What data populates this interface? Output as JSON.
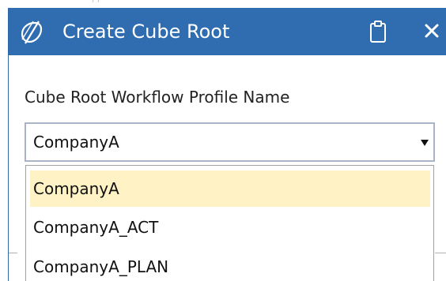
{
  "dialog": {
    "title": "Create Cube Root",
    "title_bar_color": "#2f6db0",
    "app_icon": "onestream-logo-icon",
    "actions": {
      "clipboard_icon": "clipboard-icon",
      "close_icon": "close-icon"
    }
  },
  "form": {
    "field_label": "Cube Root Workflow Profile Name",
    "combo": {
      "selected_value": "CompanyA",
      "arrow_icon": "dropdown-arrow-icon"
    },
    "dropdown": {
      "highlight_color": "#fff2c4",
      "options": [
        {
          "label": "CompanyA"
        },
        {
          "label": "CompanyA_ACT"
        },
        {
          "label": "CompanyA_PLAN"
        }
      ]
    }
  }
}
